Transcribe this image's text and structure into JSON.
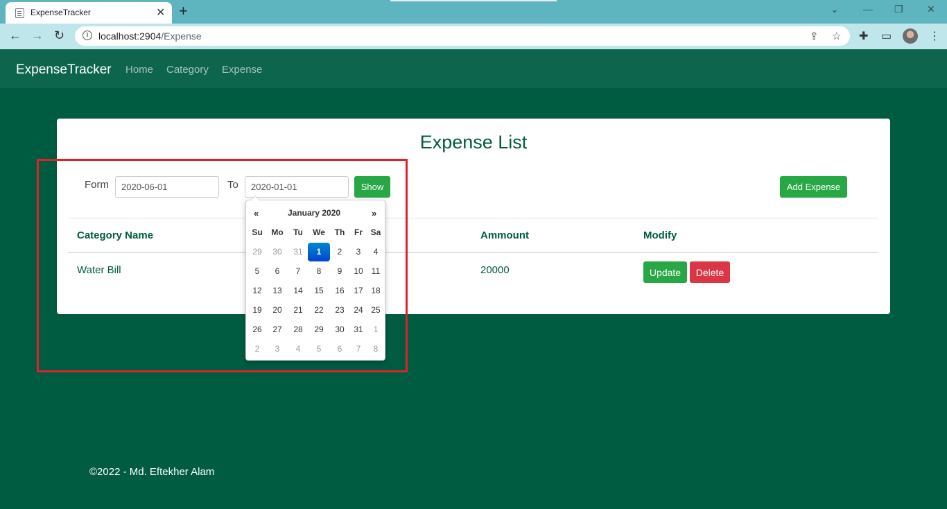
{
  "browser": {
    "tab_title": "ExpenseTracker",
    "tab_close": "✕",
    "new_tab": "+",
    "url_host": "localhost:2904",
    "url_path": "/Expense",
    "icons": [
      "back-icon",
      "forward-icon",
      "reload-icon",
      "info-icon",
      "share-icon",
      "star-icon",
      "extensions-icon",
      "cast-icon",
      "menu-icon"
    ]
  },
  "navbar": {
    "brand": "ExpenseTracker",
    "links": [
      "Home",
      "Category",
      "Expense"
    ]
  },
  "page": {
    "title": "Expense List",
    "filter": {
      "from_label": "Form",
      "from_value": "2020-06-01",
      "to_label": "To",
      "to_value": "2020-01-01",
      "show_label": "Show"
    },
    "add_label": "Add Expense",
    "table": {
      "headers": [
        "Category Name",
        "Ammount",
        "Modify"
      ],
      "rows": [
        {
          "category": "Water Bill",
          "amount": "20000",
          "update_label": "Update",
          "delete_label": "Delete"
        }
      ]
    }
  },
  "datepicker": {
    "prev": "«",
    "month_label": "January 2020",
    "next": "»",
    "weekdays": [
      "Su",
      "Mo",
      "Tu",
      "We",
      "Th",
      "Fr",
      "Sa"
    ],
    "days": [
      [
        "29",
        "30",
        "31",
        "1",
        "2",
        "3",
        "4"
      ],
      [
        "5",
        "6",
        "7",
        "8",
        "9",
        "10",
        "11"
      ],
      [
        "12",
        "13",
        "14",
        "15",
        "16",
        "17",
        "18"
      ],
      [
        "19",
        "20",
        "21",
        "22",
        "23",
        "24",
        "25"
      ],
      [
        "26",
        "27",
        "28",
        "29",
        "30",
        "31",
        "1"
      ],
      [
        "2",
        "3",
        "4",
        "5",
        "6",
        "7",
        "8"
      ]
    ],
    "selected_day": "1"
  },
  "footer": {
    "text": "©2022 - Md. Eftekher Alam"
  },
  "colors": {
    "brand_green": "#005c41",
    "navbar": "#0e654d",
    "success": "#28a745",
    "danger": "#dc3545",
    "highlight": "#e0202a"
  }
}
